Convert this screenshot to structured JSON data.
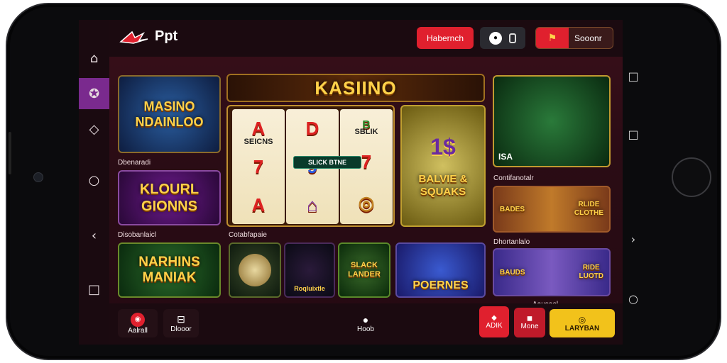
{
  "header": {
    "brand": "Ppt",
    "button_left": "Habernch",
    "button_right": "Sooonr"
  },
  "banner": {
    "title": "KASIINO"
  },
  "slot": {
    "reel1": [
      "A",
      "7",
      "A"
    ],
    "reel2": [
      "D",
      "9",
      "⌂"
    ],
    "reel3": [
      "B",
      "7",
      "◎"
    ],
    "reel1_top_label": "SEICNS",
    "reel3_top_label": "SBLIK",
    "center_badge": "SLICK BTNE"
  },
  "tiles": {
    "featured_left": "MASINO\nNDAINLOO",
    "green_right_top": "1$",
    "green_right_bottom": "BALVIE &\nSQUAKS",
    "row2_left": "KLOURL\nGIONNS",
    "row3_left": "NARHINS\nMANIAK",
    "row3_3": "Roqluixtle",
    "row3_4": "SLACK\nLANDER",
    "row3_5": "POERNES",
    "right_top_badge": "ISA",
    "right_mid_left": "BADES",
    "right_mid_right": "RLIDE\nCLOTHE",
    "right_bot_left": "BAUDS",
    "right_bot_right": "RIDE\nLUOTD"
  },
  "section_labels": {
    "a": "Dbenaradi",
    "b": "Disobanlaicl",
    "c": "Cotabfapaie",
    "d": "Contifanotalr",
    "e": "Dhortanlalo",
    "f": "Aausaol"
  },
  "bottom": {
    "btn1": "Aalrall",
    "btn2": "Dlooor",
    "btn3": "Hoob",
    "btn4": "ADIK",
    "btn5": "Mone",
    "btn6": "LARYBAN"
  },
  "colors": {
    "accent_red": "#e0202e",
    "accent_purple": "#7a2a8e",
    "gold": "#f2c21b"
  },
  "icons": {
    "nav": [
      "home-icon",
      "casino-icon",
      "cards-icon",
      "circle-icon",
      "back-icon",
      "square-icon"
    ],
    "system": [
      "square-icon",
      "square-icon",
      "back-icon",
      "circle-icon"
    ]
  }
}
